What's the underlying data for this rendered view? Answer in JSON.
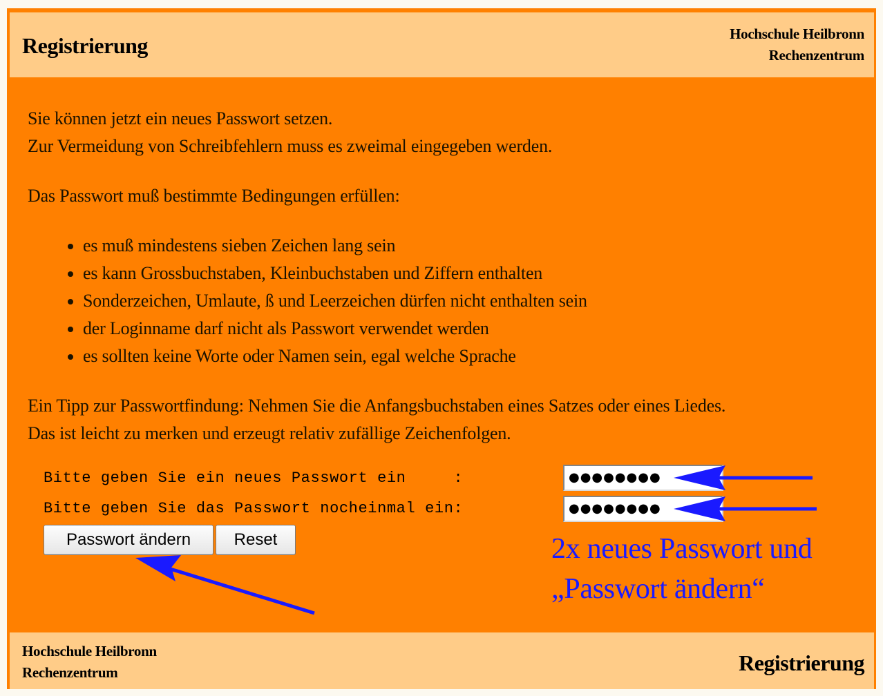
{
  "header": {
    "title": "Registrierung",
    "org_line1": "Hochschule Heilbronn",
    "org_line2": "Rechenzentrum"
  },
  "intro": {
    "line1": "Sie können jetzt ein neues Passwort setzen.",
    "line2": "Zur Vermeidung von Schreibfehlern muss es zweimal eingegeben werden.",
    "conditions_heading": "Das Passwort muß bestimmte Bedingungen erfüllen:"
  },
  "rules": [
    "es muß mindestens sieben Zeichen lang sein",
    "es kann Grossbuchstaben, Kleinbuchstaben und Ziffern enthalten",
    "Sonderzeichen, Umlaute, ß und Leerzeichen dürfen nicht enthalten sein",
    "der Loginname darf nicht als Passwort verwendet werden",
    "es sollten keine Worte oder Namen sein, egal welche Sprache"
  ],
  "tip": {
    "line1": "Ein Tipp zur Passwortfindung: Nehmen Sie die Anfangsbuchstaben eines Satzes oder eines Liedes.",
    "line2": "Das ist leicht zu merken und erzeugt relativ zufällige Zeichenfolgen."
  },
  "form": {
    "label_new": "Bitte geben Sie ein neues Passwort ein     :",
    "label_repeat": "Bitte geben Sie das Passwort nocheinmal ein:",
    "value_new": "●●●●●●●●",
    "value_repeat": "●●●●●●●●",
    "submit_label": "Passwort ändern",
    "reset_label": "Reset"
  },
  "annotation": {
    "text": "2x neues Passwort und\n„Passwort ändern“",
    "color": "#1a1aff"
  },
  "footer": {
    "org_line1": "Hochschule Heilbronn",
    "org_line2": "Rechenzentrum",
    "title": "Registrierung"
  },
  "colors": {
    "page_background": "#ff8000",
    "bar_background": "#ffcc88",
    "arrow": "#1a1aff"
  }
}
